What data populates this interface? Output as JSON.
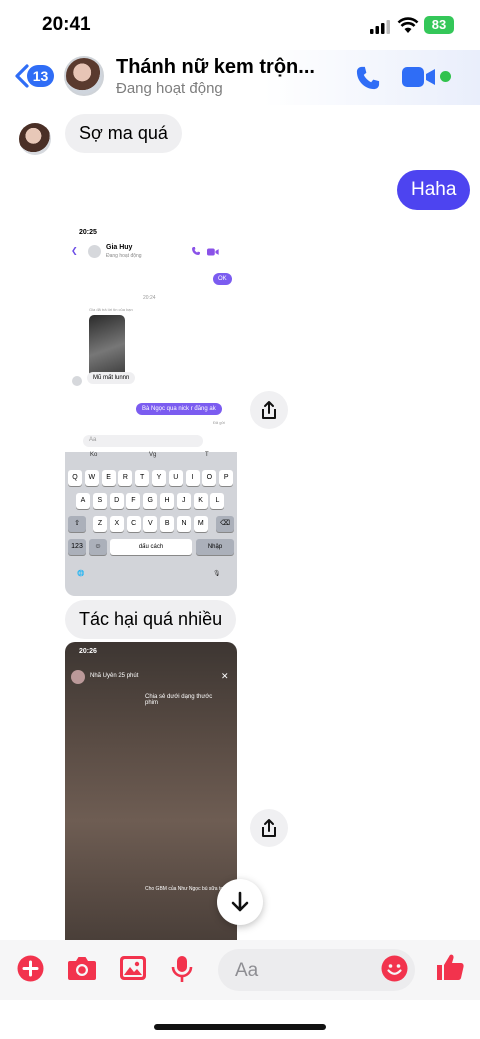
{
  "status_bar": {
    "time": "20:41",
    "battery": "83"
  },
  "header": {
    "back_count": "13",
    "contact_name": "Thánh nữ kem trộn...",
    "contact_status": "Đang hoạt động"
  },
  "messages": {
    "first_in": "Sợ ma quá",
    "first_out": "Haha",
    "second_in": "Tác hại quá nhiều"
  },
  "embedded_screenshot": {
    "time": "20:25",
    "name": "Gia Huy",
    "status": "Đang hoạt động",
    "ok": "OK",
    "date": "20:24",
    "forwarded": "Gia đã trả lời tin của bạn",
    "in_text": "Mũ mất lunnn",
    "out_text": "Bà Ngọc qua nick r đăng ak",
    "sent": "Đã gửi",
    "input_placeholder": "Aa",
    "suggestions": [
      "Ko",
      "Vg",
      "T"
    ],
    "keys_row1": [
      "Q",
      "W",
      "E",
      "R",
      "T",
      "Y",
      "U",
      "I",
      "O",
      "P"
    ],
    "keys_row2": [
      "A",
      "S",
      "D",
      "F",
      "G",
      "H",
      "J",
      "K",
      "L"
    ],
    "keys_row3": [
      "Z",
      "X",
      "C",
      "V",
      "B",
      "N",
      "M"
    ],
    "key_123": "123",
    "space_label": "dấu cách",
    "return_label": "Nhập"
  },
  "embedded_story": {
    "time": "20:26",
    "name": "Nhã Uyên 25 phút",
    "caption": "Chia sẻ dưới dạng thước phim",
    "bottom_text": "Cho GBM của Như Ngọc bú sữa to ri"
  },
  "composer": {
    "placeholder": "Aa"
  },
  "colors": {
    "accent": "#4d44f0",
    "messenger_blue": "#2f6df6",
    "icon_red": "#f2334d"
  }
}
